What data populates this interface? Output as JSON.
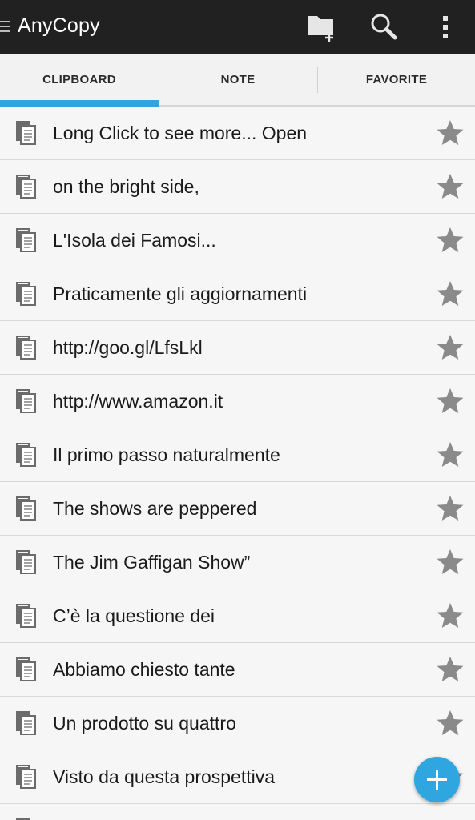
{
  "app": {
    "title": "AnyCopy"
  },
  "actionbar": {
    "icons": [
      "menu-lines-icon",
      "folder-add-icon",
      "search-icon",
      "more-vert-icon"
    ]
  },
  "tabs": [
    {
      "label": "CLIPBOARD",
      "selected": true
    },
    {
      "label": "NOTE",
      "selected": false
    },
    {
      "label": "FAVORITE",
      "selected": false
    }
  ],
  "clips": [
    {
      "text": "Long Click to see more...  Open"
    },
    {
      "text": "on the bright side,"
    },
    {
      "text": "L'Isola dei Famosi..."
    },
    {
      "text": "Praticamente gli aggiornamenti"
    },
    {
      "text": "http://goo.gl/LfsLkl"
    },
    {
      "text": "http://www.amazon.it"
    },
    {
      "text": "Il primo passo naturalmente"
    },
    {
      "text": "The shows are peppered"
    },
    {
      "text": "The Jim Gaffigan Show”"
    },
    {
      "text": "C’è la questione dei"
    },
    {
      "text": "Abbiamo chiesto tante"
    },
    {
      "text": "Un prodotto su quattro"
    },
    {
      "text": "Visto da questa prospettiva"
    }
  ],
  "fab": {
    "icon": "plus-icon"
  },
  "colors": {
    "actionbar": "#212121",
    "accent": "#33a3dc",
    "fab": "#2fa6df",
    "star": "#8a8a8a"
  }
}
